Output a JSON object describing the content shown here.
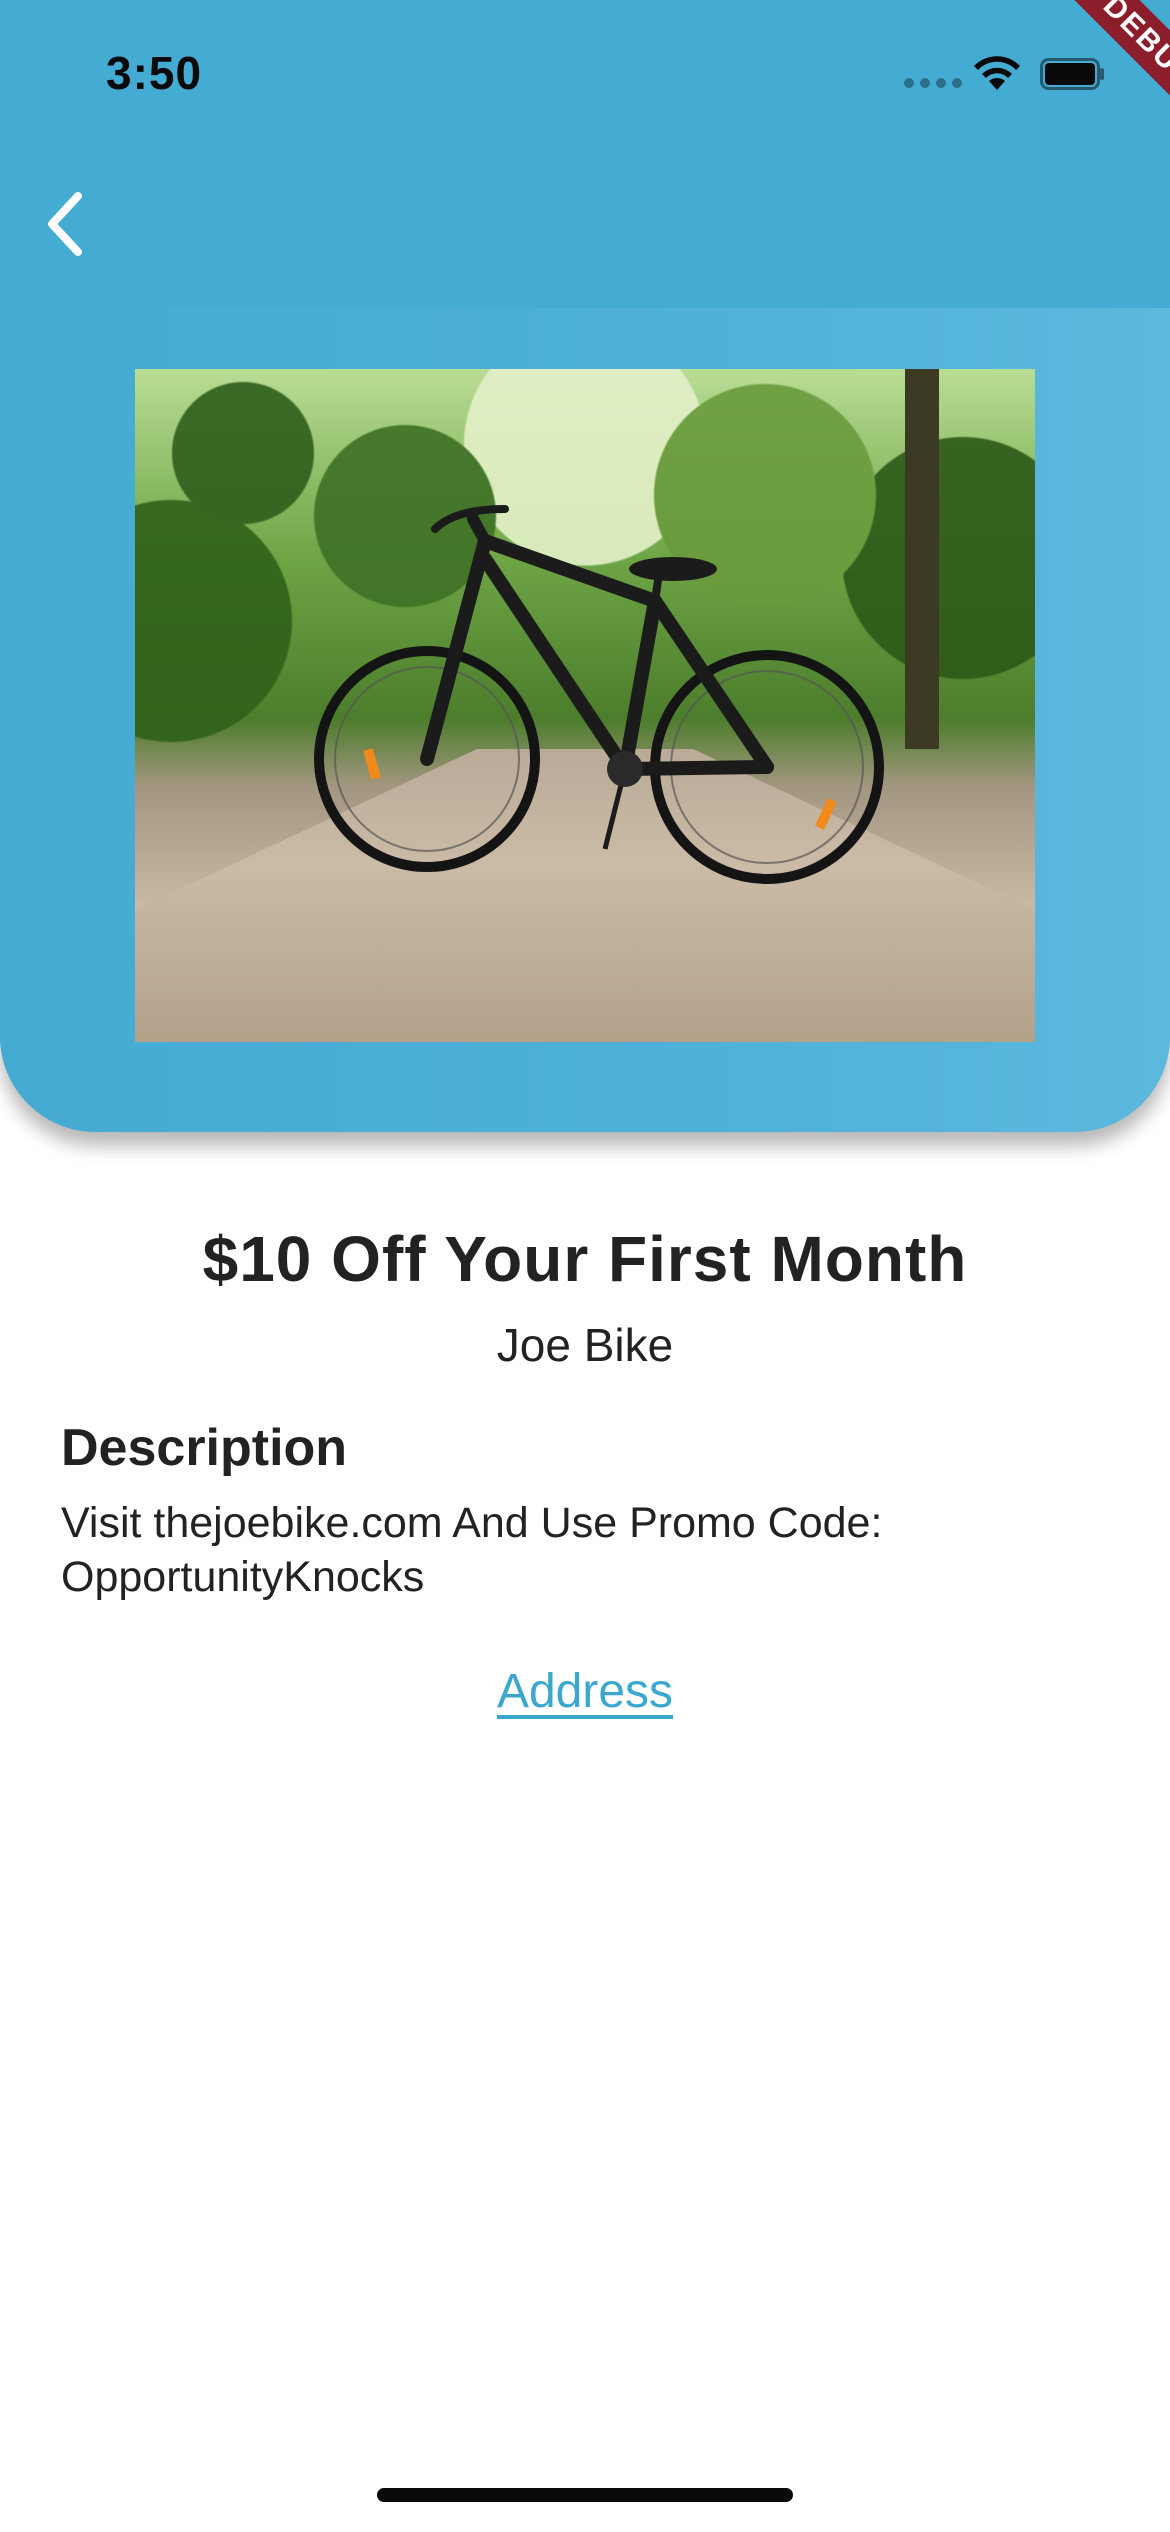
{
  "status_bar": {
    "time": "3:50",
    "debug_label": "DEBUG"
  },
  "icons": {
    "back": "chevron-left-icon",
    "wifi": "wifi-icon",
    "battery": "battery-icon"
  },
  "colors": {
    "header_blue": "#44abd2",
    "link_blue": "#3ba7cf",
    "text": "#222222",
    "debug_banner": "#8c1d2b"
  },
  "offer": {
    "title": "$10 Off Your First Month",
    "merchant": "Joe Bike",
    "description_heading": "Description",
    "description_line1": "Visit thejoebike.com And Use Promo Code:",
    "description_line2": "OpportunityKnocks",
    "address_link": "Address"
  }
}
